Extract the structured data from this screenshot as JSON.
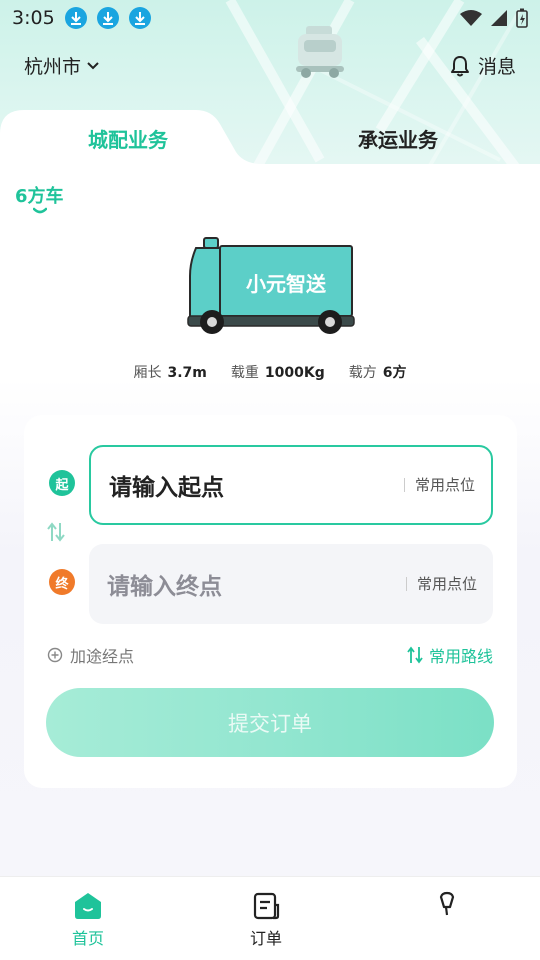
{
  "status_bar": {
    "time": "3:05"
  },
  "header": {
    "city": "杭州市",
    "message_label": "消息"
  },
  "tabs": [
    {
      "label": "城配业务",
      "active": true
    },
    {
      "label": "承运业务",
      "active": false
    }
  ],
  "vehicle": {
    "type": "6方车",
    "brand_text": "小元智送",
    "specs": [
      {
        "label": "厢长",
        "value": "3.7m"
      },
      {
        "label": "载重",
        "value": "1000Kg"
      },
      {
        "label": "载方",
        "value": "6方"
      }
    ]
  },
  "address": {
    "start_badge": "起",
    "end_badge": "终",
    "start_placeholder": "请输入起点",
    "end_placeholder": "请输入终点",
    "common_point": "常用点位",
    "waypoint": "加途经点",
    "common_route": "常用路线"
  },
  "submit_label": "提交订单",
  "bottom_nav": [
    {
      "label": "首页",
      "active": true
    },
    {
      "label": "订单",
      "active": false
    },
    {
      "label": "",
      "active": false
    }
  ],
  "colors": {
    "accent": "#1fc39a",
    "end_badge": "#f07a2a",
    "download_icon": "#1aa5e0"
  }
}
